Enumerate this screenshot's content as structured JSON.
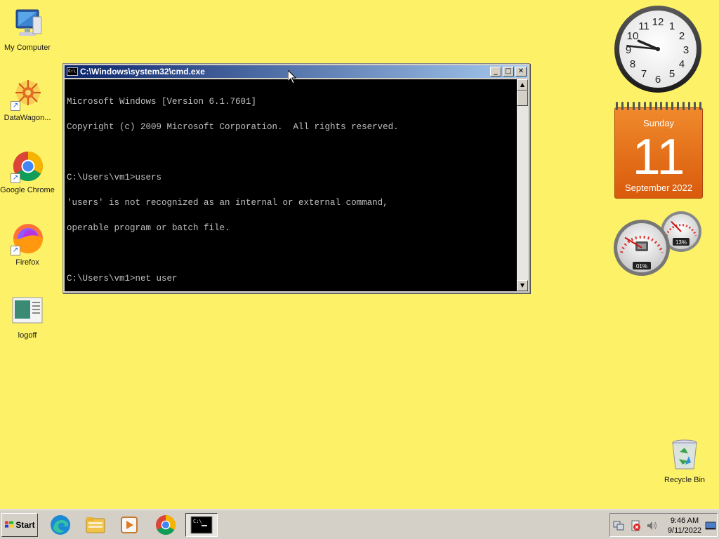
{
  "desktop": {
    "icons": [
      {
        "label": "My Computer"
      },
      {
        "label": "DataWagon..."
      },
      {
        "label": "Google Chrome"
      },
      {
        "label": "Firefox"
      },
      {
        "label": "logoff"
      }
    ],
    "recycle_bin": {
      "label": "Recycle Bin"
    }
  },
  "cmd_window": {
    "title": "C:\\Windows\\system32\\cmd.exe",
    "minimize_glyph": "_",
    "maximize_glyph": "□",
    "close_glyph": "✕",
    "lines": [
      "Microsoft Windows [Version 6.1.7601]",
      "Copyright (c) 2009 Microsoft Corporation.  All rights reserved.",
      "",
      "C:\\Users\\vm1>users",
      "'users' is not recognized as an internal or external command,",
      "operable program or batch file.",
      "",
      "C:\\Users\\vm1>net user"
    ]
  },
  "gadgets": {
    "clock": {
      "time": "9:46",
      "hour": 9,
      "minute": 46
    },
    "calendar": {
      "day_of_week": "Sunday",
      "day": "11",
      "month_year": "September 2022"
    },
    "cpu_meter": {
      "cpu_percent": "01%",
      "memory_percent": "13%",
      "cpu_value": 1,
      "memory_value": 13
    }
  },
  "taskbar": {
    "start_label": "Start",
    "apps": [
      {
        "name": "edge-icon"
      },
      {
        "name": "explorer-icon"
      },
      {
        "name": "media-player-icon"
      },
      {
        "name": "chrome-icon"
      },
      {
        "name": "cmd-icon",
        "active": true
      }
    ],
    "tray": {
      "time": "9:46 AM",
      "date": "9/11/2022"
    }
  },
  "colors": {
    "desktop_background": "#fdf167",
    "titlebar_start": "#0a246a",
    "titlebar_end": "#a6caf0",
    "calendar_orange": "#e8701a"
  }
}
